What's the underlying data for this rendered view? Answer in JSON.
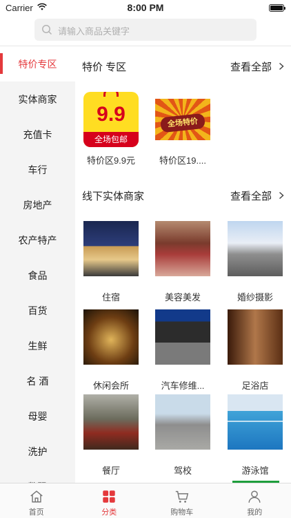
{
  "status": {
    "carrier": "Carrier",
    "time": "8:00 PM"
  },
  "search": {
    "placeholder": "请输入商品关键字"
  },
  "sidebar": {
    "items": [
      {
        "label": "特价专区",
        "active": true
      },
      {
        "label": "实体商家"
      },
      {
        "label": "充值卡"
      },
      {
        "label": "车行"
      },
      {
        "label": "房地产"
      },
      {
        "label": "农产特产"
      },
      {
        "label": "食品"
      },
      {
        "label": "百货"
      },
      {
        "label": "生鲜"
      },
      {
        "label": "名 酒"
      },
      {
        "label": "母婴"
      },
      {
        "label": "洗护"
      },
      {
        "label": "数码"
      }
    ]
  },
  "sections": [
    {
      "title": "特价 专区",
      "more": "查看全部",
      "items": [
        {
          "label": "特价区9.9元",
          "thumb_text": "9.9",
          "thumb_band": "全场包邮"
        },
        {
          "label": "特价区19....",
          "thumb_text": "全场特价"
        }
      ]
    },
    {
      "title": "线下实体商家",
      "more": "查看全部",
      "items": [
        {
          "label": "住宿"
        },
        {
          "label": "美容美发"
        },
        {
          "label": "婚纱摄影"
        },
        {
          "label": "休闲会所"
        },
        {
          "label": "汽车修维..."
        },
        {
          "label": "足浴店"
        },
        {
          "label": "餐厅"
        },
        {
          "label": "驾校"
        },
        {
          "label": "游泳馆"
        }
      ]
    }
  ],
  "tabbar": {
    "items": [
      {
        "label": "首页",
        "icon": "home-icon"
      },
      {
        "label": "分类",
        "icon": "category-icon",
        "active": true
      },
      {
        "label": "购物车",
        "icon": "cart-icon"
      },
      {
        "label": "我的",
        "icon": "profile-icon"
      }
    ]
  },
  "colors": {
    "accent": "#e4393c",
    "sidebar_bg": "#f4f4f4"
  }
}
